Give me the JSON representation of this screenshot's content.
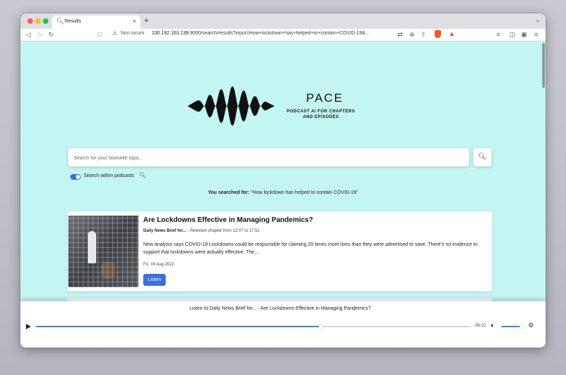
{
  "browser": {
    "tab_title": "Results",
    "tab_favicon": "search-icon",
    "new_tab_label": "+",
    "tab_menu_label": "⌄",
    "security_label": "Non sicuro",
    "url_host": "130.192.163.139",
    "url_rest": ":9000/search/results?input=How+lockdown+has+helped+to+contain+COVID-19&..."
  },
  "header": {
    "brand_name": "PACE",
    "brand_tagline": "PODCAST AI FOR CHAPTERS AND EPISODES"
  },
  "search": {
    "placeholder": "Search for your favourite topic...",
    "value": "",
    "button_icon": "search-icon",
    "toggle_label": "Search within podcasts",
    "toggle_on": true
  },
  "results_summary": {
    "prefix": "You searched for:",
    "query": "\"How lockdown has helped to contain COVID-19\""
  },
  "results": [
    {
      "title": "Are Lockdowns Effective in Managing Pandemics?",
      "podcast": "Daily News Brief for...",
      "chapter": " - Relevant chapter from 12:07 to 17:51",
      "description": "New analysis says COVID-19 Lockdowns could be responsible for claiming 20 times more lives than they were advertised to save. There's no evidence to support that lockdowns were actually effective. The...",
      "date": "Fri, 19 Aug 2022",
      "listen_label": "Listen"
    }
  ],
  "player": {
    "title": "Listen to Daily News Brief for... - Are Lockdowns Effective in Managing Pandemics?",
    "progress_fraction": 0.655,
    "time_remaining": "-06:22",
    "volume_fraction": 0.95
  },
  "colors": {
    "page_background": "#c3f5f1",
    "accent": "#3b6fe0"
  }
}
